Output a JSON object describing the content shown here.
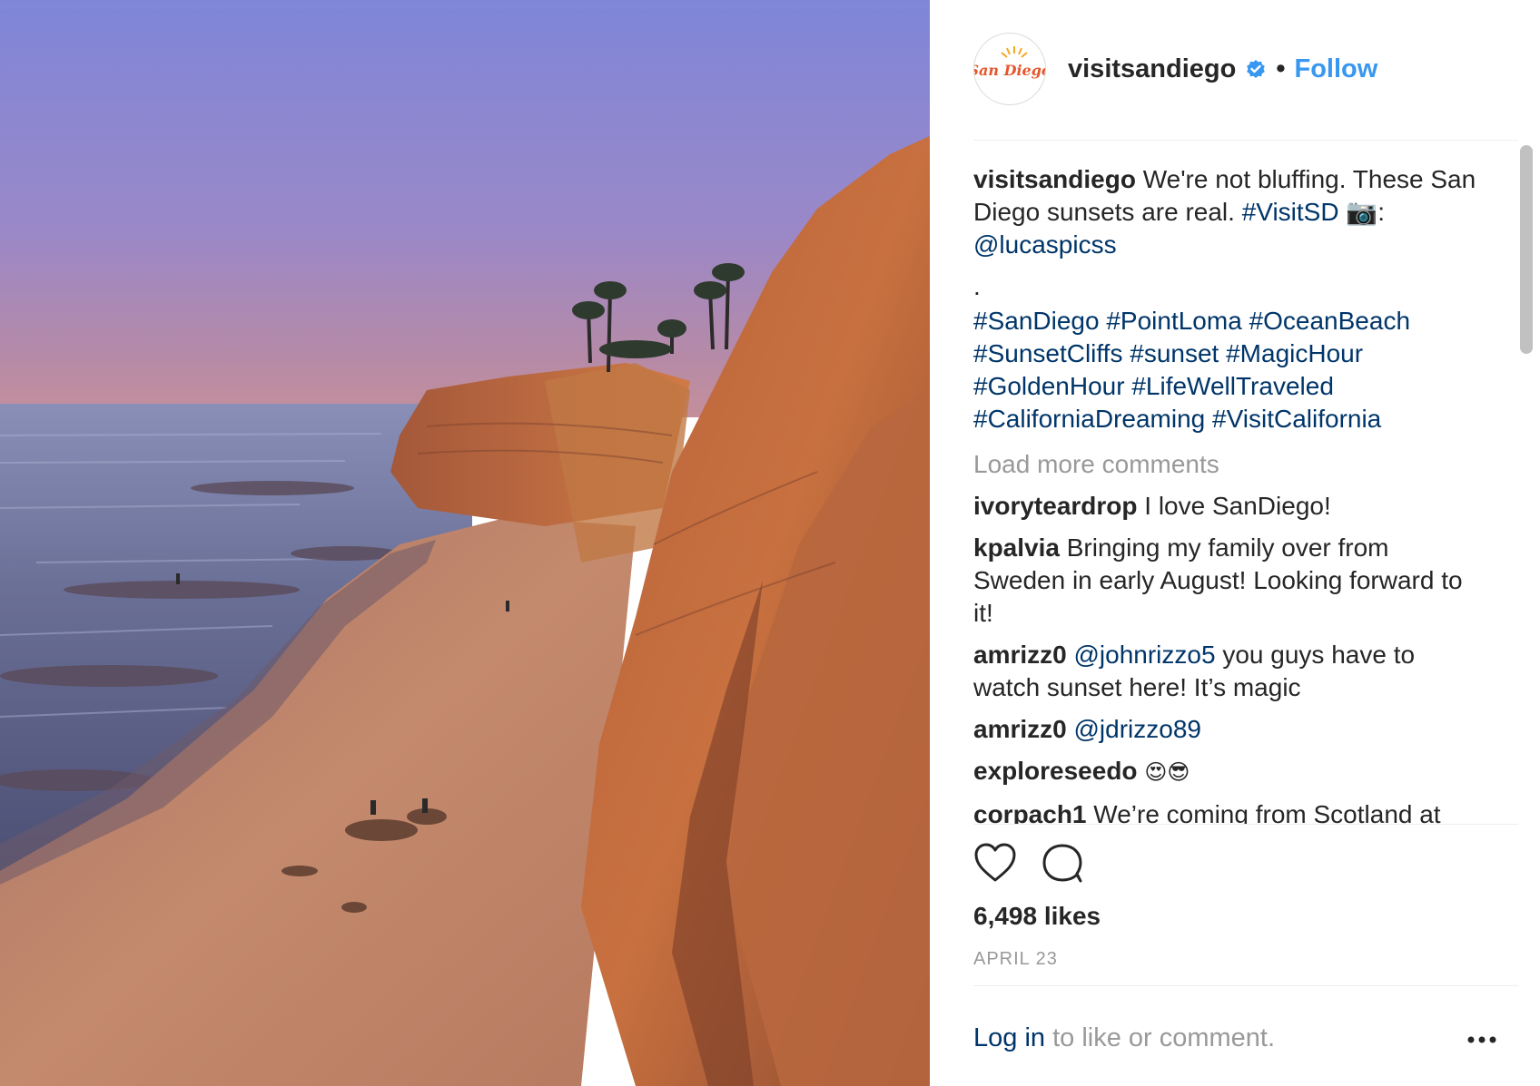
{
  "post": {
    "username": "visitsandiego",
    "avatar_text": "San Diego",
    "separator": "•",
    "follow_label": "Follow",
    "caption": {
      "username": "visitsandiego",
      "text": "We're not bluffing. These San Diego sunsets are real.",
      "hashtag1": "#VisitSD",
      "camera_emoji": "📷:",
      "mention": "@lucaspicss",
      "dot": ".",
      "tags": [
        "#SanDiego",
        "#PointLoma",
        "#OceanBeach",
        "#SunsetCliffs",
        "#sunset",
        "#MagicHour",
        "#GoldenHour",
        "#LifeWellTraveled",
        "#CaliforniaDreaming",
        "#VisitCalifornia"
      ]
    },
    "load_more": "Load more comments",
    "comments": [
      {
        "username": "ivoryteardrop",
        "text": "I love SanDiego!"
      },
      {
        "username": "kpalvia",
        "text": "Bringing my family over from Sweden in early August! Looking forward to it!"
      },
      {
        "username": "amrizz0",
        "mention": "@johnrizzo5",
        "text": "you guys have to watch sunset here! It’s magic"
      },
      {
        "username": "amrizz0",
        "mention": "@jdrizzo89",
        "text": ""
      },
      {
        "username": "exploreseedo",
        "text": "😍😎"
      },
      {
        "username": "corpach1",
        "text": "We’re coming from Scotland at"
      }
    ],
    "likes": "6,498 likes",
    "date": "APRIL 23",
    "footer": {
      "login": "Log in",
      "text": "to like or comment."
    },
    "icons": [
      "verified-badge-icon",
      "heart-icon",
      "comment-icon",
      "more-dots-icon"
    ]
  },
  "colors": {
    "link": "#3897f0",
    "hashtag": "#003569",
    "muted": "#999999",
    "text": "#262626"
  }
}
